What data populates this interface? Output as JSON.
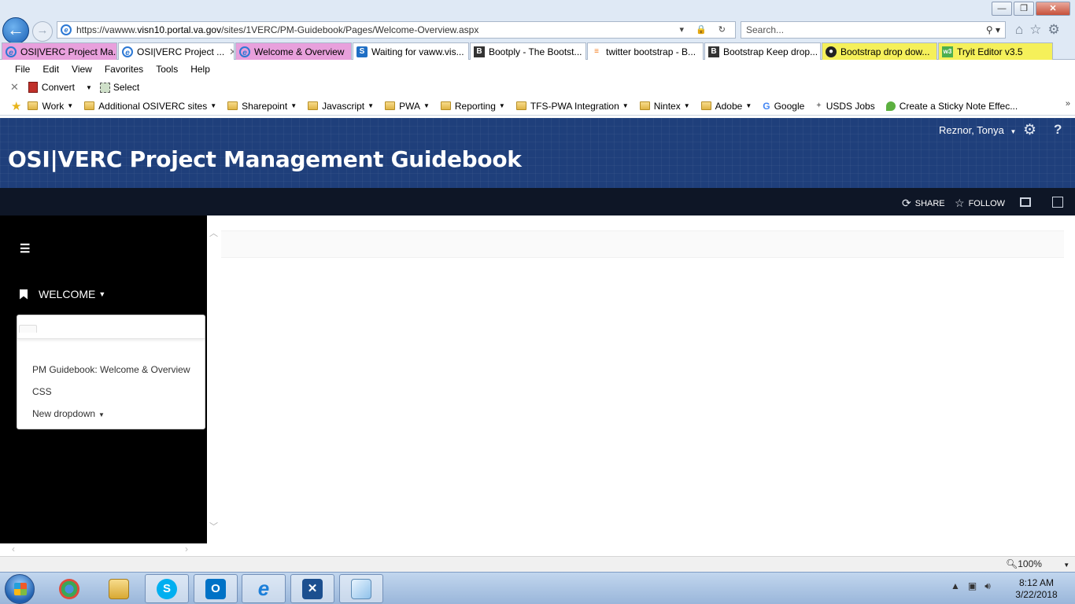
{
  "window": {
    "minimize": "—",
    "restore": "❐",
    "close": "✕"
  },
  "address": {
    "prefix": "https://vawww.",
    "domain": "visn10.portal.va.gov",
    "path": "/sites/1VERC/PM-Guidebook/Pages/Welcome-Overview.aspx",
    "tools": "▾ 🔒 ↻"
  },
  "search": {
    "placeholder": "Search...",
    "tools": "⚲ ▾"
  },
  "tabs": [
    {
      "label": "OSI|VERC Project Ma...",
      "icon": "ie-icon",
      "bg": "#e8a0dc"
    },
    {
      "label": "OSI|VERC Project ...",
      "icon": "ie-icon",
      "bg": "#ffffff",
      "close": "✕"
    },
    {
      "label": "Welcome & Overview",
      "icon": "ie-icon",
      "bg": "#e8a0dc"
    },
    {
      "label": "Waiting for vaww.vis...",
      "icon": "sharepoint-icon",
      "bg": "#ffffff"
    },
    {
      "label": "Bootply - The Bootst...",
      "icon": "bootply-icon",
      "bg": "#ffffff"
    },
    {
      "label": "twitter bootstrap - B...",
      "icon": "stackoverflow-icon",
      "bg": "#ffffff"
    },
    {
      "label": "Bootstrap Keep drop...",
      "icon": "bootply-icon",
      "bg": "#ffffff"
    },
    {
      "label": "Bootstrap drop dow...",
      "icon": "github-icon",
      "bg": "#f5f05a"
    },
    {
      "label": "Tryit Editor v3.5",
      "icon": "w3schools-icon",
      "bg": "#f5f05a"
    }
  ],
  "menu": [
    "File",
    "Edit",
    "View",
    "Favorites",
    "Tools",
    "Help"
  ],
  "commands": {
    "close": "✕",
    "convert": "Convert",
    "select": "Select"
  },
  "favorites": {
    "folders": [
      "Work",
      "Additional OSIVERC sites",
      "Sharepoint",
      "Javascript",
      "PWA",
      "Reporting",
      "TFS-PWA Integration",
      "Nintex",
      "Adobe"
    ],
    "google": "Google",
    "usds": "USDS Jobs",
    "sticky": "Create a Sticky Note Effec...",
    "more": "»"
  },
  "sharepoint": {
    "user": "Reznor, Tonya",
    "site_title": "OSI|VERC Project Management Guidebook",
    "share": "SHARE",
    "follow": "FOLLOW",
    "nav_heading": "WELCOME",
    "dropdown_items": [
      "PM Guidebook: Welcome & Overview",
      "CSS",
      "New dropdown"
    ]
  },
  "status": {
    "zoom": "100%"
  },
  "taskbar": {
    "time": "8:12 AM",
    "date": "3/22/2018",
    "apps": [
      "chrome",
      "file-explorer",
      "skype",
      "outlook",
      "internet-explorer",
      "tools",
      "notepad"
    ]
  },
  "colors": {
    "suitebar": "#1f3f7b",
    "ribbon": "#0e1626",
    "sidenav": "#000000"
  }
}
